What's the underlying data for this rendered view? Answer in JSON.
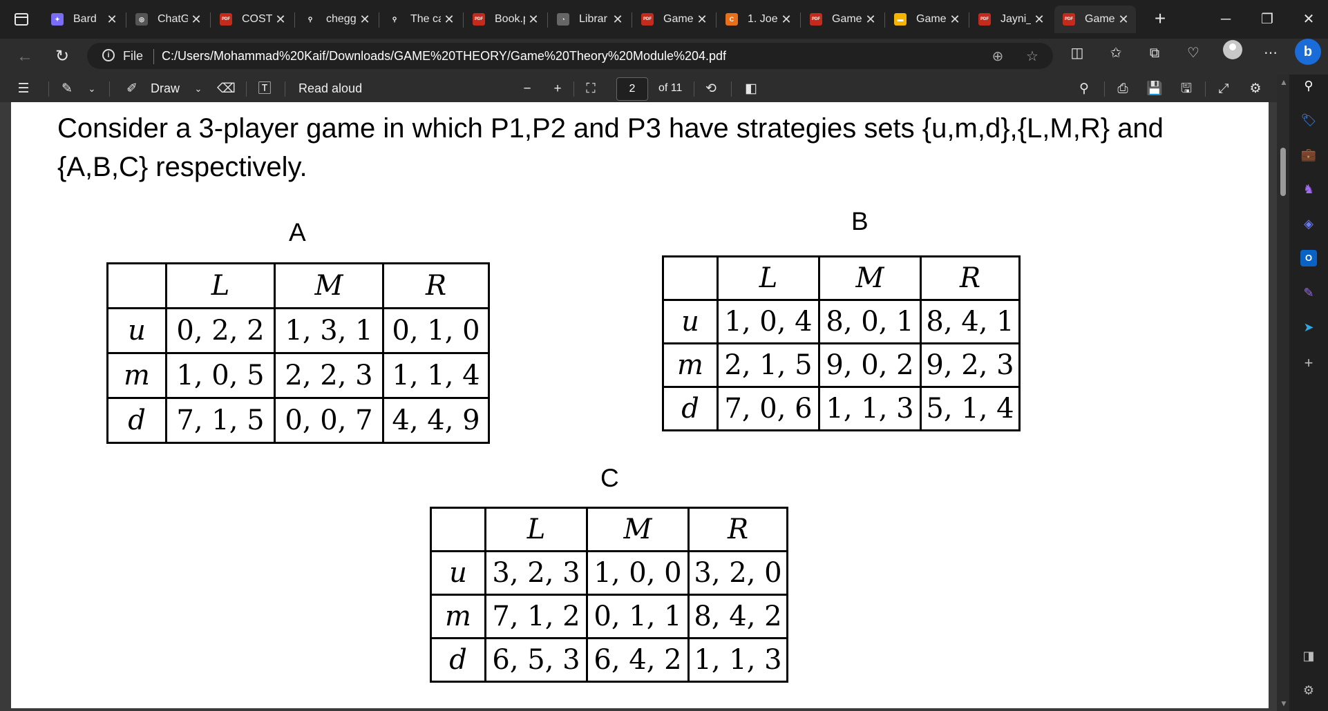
{
  "browser": {
    "tabs": [
      {
        "label": "Bard",
        "icon": "bard-icon",
        "color": "#7a6cf5",
        "glyph": "✦",
        "active": false
      },
      {
        "label": "ChatG",
        "icon": "chatgpt-icon",
        "color": "#555555",
        "glyph": "◎",
        "active": false
      },
      {
        "label": "COST",
        "icon": "pdf-icon",
        "color": "#c42b1c",
        "glyph": "PDF",
        "active": false
      },
      {
        "label": "chegg",
        "icon": "search-icon",
        "color": "#202020",
        "glyph": "⚲",
        "active": false
      },
      {
        "label": "The ca",
        "icon": "search-icon",
        "color": "#202020",
        "glyph": "⚲",
        "active": false
      },
      {
        "label": "Book.p",
        "icon": "pdf-icon",
        "color": "#c42b1c",
        "glyph": "PDF",
        "active": false
      },
      {
        "label": "Librar",
        "icon": "library-icon",
        "color": "#666666",
        "glyph": "◔",
        "active": false
      },
      {
        "label": "Game",
        "icon": "pdf-icon",
        "color": "#c42b1c",
        "glyph": "PDF",
        "active": false
      },
      {
        "label": "1. Joe",
        "icon": "c-icon",
        "color": "#e8701a",
        "glyph": "C",
        "active": false
      },
      {
        "label": "Game",
        "icon": "pdf-icon",
        "color": "#c42b1c",
        "glyph": "PDF",
        "active": false
      },
      {
        "label": "Game",
        "icon": "slides-icon",
        "color": "#f4b400",
        "glyph": "▬",
        "active": false
      },
      {
        "label": "Jayni_",
        "icon": "pdf-icon",
        "color": "#c42b1c",
        "glyph": "PDF",
        "active": false
      },
      {
        "label": "Game",
        "icon": "pdf-icon",
        "color": "#c42b1c",
        "glyph": "PDF",
        "active": true
      }
    ],
    "address": {
      "scheme_label": "File",
      "url": "C:/Users/Mohammad%20Kaif/Downloads/GAME%20THEORY/Game%20Theory%20Module%204.pdf"
    }
  },
  "pdf_toolbar": {
    "draw_label": "Draw",
    "read_aloud_label": "Read aloud",
    "page_current": "2",
    "page_total": "of 11"
  },
  "document": {
    "question": "Consider a 3-player game in which P1,P2 and P3 have strategies sets {u,m,d},{L,M,R} and {A,B,C} respectively.",
    "tables": [
      {
        "label": "A",
        "columns": [
          "L",
          "M",
          "R"
        ],
        "rows": [
          {
            "head": "u",
            "cells": [
              "0, 2, 2",
              "1, 3, 1",
              "0, 1, 0"
            ]
          },
          {
            "head": "m",
            "cells": [
              "1, 0, 5",
              "2, 2, 3",
              "1, 1, 4"
            ]
          },
          {
            "head": "d",
            "cells": [
              "7, 1, 5",
              "0, 0, 7",
              "4, 4, 9"
            ]
          }
        ]
      },
      {
        "label": "B",
        "columns": [
          "L",
          "M",
          "R"
        ],
        "rows": [
          {
            "head": "u",
            "cells": [
              "1, 0, 4",
              "8, 0, 1",
              "8, 4, 1"
            ]
          },
          {
            "head": "m",
            "cells": [
              "2, 1, 5",
              "9, 0, 2",
              "9, 2, 3"
            ]
          },
          {
            "head": "d",
            "cells": [
              "7, 0, 6",
              "1, 1, 3",
              "5, 1, 4"
            ]
          }
        ]
      },
      {
        "label": "C",
        "columns": [
          "L",
          "M",
          "R"
        ],
        "rows": [
          {
            "head": "u",
            "cells": [
              "3, 2, 3",
              "1, 0, 0",
              "3, 2, 0"
            ]
          },
          {
            "head": "m",
            "cells": [
              "7, 1, 2",
              "0, 1, 1",
              "8, 4, 2"
            ]
          },
          {
            "head": "d",
            "cells": [
              "6, 5, 3",
              "6, 4, 2",
              "1, 1, 3"
            ]
          }
        ]
      }
    ]
  }
}
